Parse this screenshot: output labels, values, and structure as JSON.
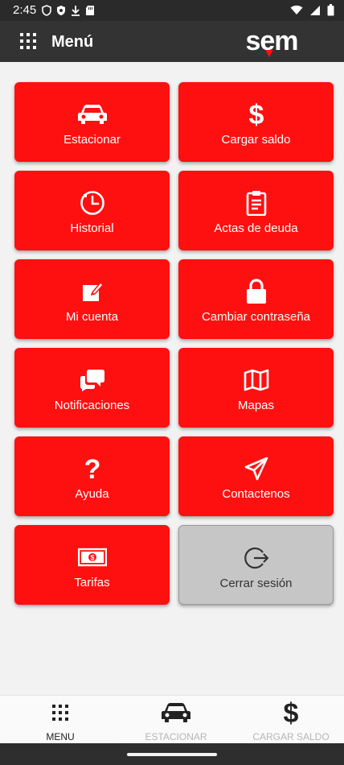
{
  "status_bar": {
    "time": "2:45",
    "left_icons": [
      "shield-icon",
      "shield-play-icon",
      "download-icon",
      "sd-card-icon"
    ],
    "right_icons": [
      "wifi-icon",
      "signal-icon",
      "battery-icon"
    ]
  },
  "app_bar": {
    "title": "Menú",
    "logo_text": "sem",
    "logo_accent": "#ff1010"
  },
  "menu": {
    "tiles": [
      {
        "label": "Estacionar",
        "icon": "car-icon"
      },
      {
        "label": "Cargar saldo",
        "icon": "dollar-icon"
      },
      {
        "label": "Historial",
        "icon": "clock-icon"
      },
      {
        "label": "Actas de deuda",
        "icon": "clipboard-icon"
      },
      {
        "label": "Mi cuenta",
        "icon": "edit-icon"
      },
      {
        "label": "Cambiar contraseña",
        "icon": "lock-icon"
      },
      {
        "label": "Notificaciones",
        "icon": "chat-bubbles-icon"
      },
      {
        "label": "Mapas",
        "icon": "map-icon"
      },
      {
        "label": "Ayuda",
        "icon": "question-icon"
      },
      {
        "label": "Contactenos",
        "icon": "send-icon"
      },
      {
        "label": "Tarifas",
        "icon": "money-bill-icon"
      },
      {
        "label": "Cerrar sesión",
        "icon": "logout-icon"
      }
    ]
  },
  "bottom_nav": {
    "items": [
      {
        "label": "MENU",
        "icon": "grid-icon",
        "active": true
      },
      {
        "label": "ESTACIONAR",
        "icon": "car-icon",
        "active": false
      },
      {
        "label": "CARGAR SALDO",
        "icon": "dollar-icon",
        "active": false
      }
    ]
  },
  "colors": {
    "primary": "#ff1010",
    "app_bar": "#333333",
    "logout_tile": "#c6c6c6",
    "background": "#f2f2f2"
  }
}
